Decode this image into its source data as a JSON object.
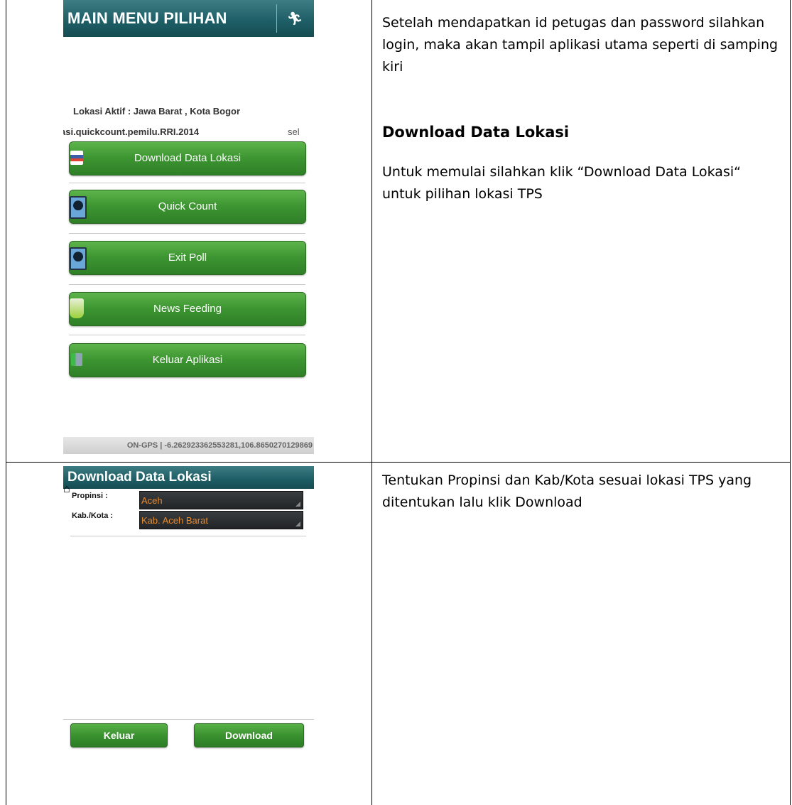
{
  "screen1": {
    "title": "MAIN MENU PILIHAN",
    "exit_icon": "running-man-icon",
    "location_label": "Lokasi Aktif : Jawa Barat , Kota Bogor",
    "app_id": "asi.quickcount.pemilu.RRI.2014",
    "app_id_right": "sel",
    "menu": [
      {
        "label": "Download Data Lokasi",
        "icon": "map-icon"
      },
      {
        "label": "Quick Count",
        "icon": "person-icon"
      },
      {
        "label": "Exit Poll",
        "icon": "person-icon"
      },
      {
        "label": "News Feeding",
        "icon": "bucket-icon"
      },
      {
        "label": "Keluar Aplikasi",
        "icon": "exit-door-icon"
      }
    ],
    "status": "ON-GPS | -6.262923362553281,106.8650270129869"
  },
  "screen2": {
    "title": "Download Data Lokasi",
    "home_icon": "home-icon",
    "propinsi_label": "Propinsi :",
    "propinsi_value": "Aceh",
    "kab_label": "Kab./Kota :",
    "kab_value": "Kab. Aceh Barat",
    "keluar_label": "Keluar",
    "download_label": "Download"
  },
  "right1": {
    "intro": "Setelah mendapatkan id petugas dan password silahkan login, maka akan tampil aplikasi utama seperti di samping kiri",
    "heading": "Download Data Lokasi",
    "body": "Untuk memulai silahkan klik “Download Data Lokasi“ untuk pilihan lokasi TPS"
  },
  "right2": {
    "body": "Tentukan Propinsi dan Kab/Kota sesuai lokasi TPS yang ditentukan lalu klik Download"
  }
}
